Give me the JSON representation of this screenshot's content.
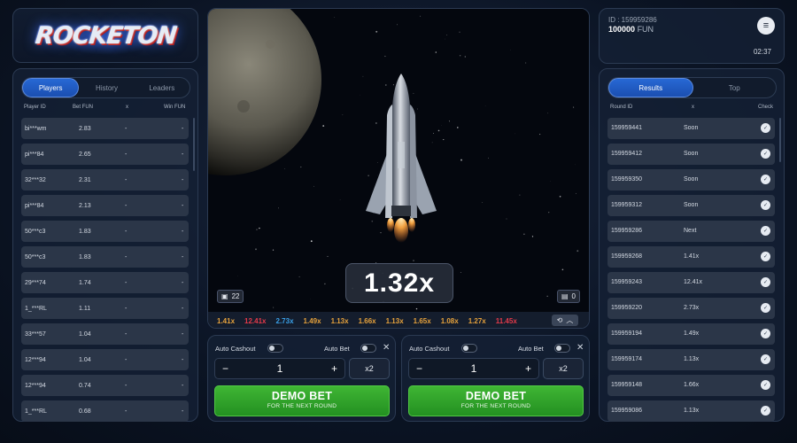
{
  "logo": {
    "text": "ROCKETON"
  },
  "players": {
    "tabs": [
      "Players",
      "History",
      "Leaders"
    ],
    "columns": {
      "id": "Player ID",
      "bet": "Bet  FUN",
      "x": "x",
      "win": "Win  FUN"
    },
    "rows": [
      {
        "id": "bi***wm",
        "bet": "2.83",
        "x": "-",
        "win": "-"
      },
      {
        "id": "pi***84",
        "bet": "2.65",
        "x": "-",
        "win": "-"
      },
      {
        "id": "32***32",
        "bet": "2.31",
        "x": "-",
        "win": "-"
      },
      {
        "id": "pi***84",
        "bet": "2.13",
        "x": "-",
        "win": "-"
      },
      {
        "id": "50***c3",
        "bet": "1.83",
        "x": "-",
        "win": "-"
      },
      {
        "id": "50***c3",
        "bet": "1.83",
        "x": "-",
        "win": "-"
      },
      {
        "id": "29***74",
        "bet": "1.74",
        "x": "-",
        "win": "-"
      },
      {
        "id": "1_***RL",
        "bet": "1.11",
        "x": "-",
        "win": "-"
      },
      {
        "id": "33***57",
        "bet": "1.04",
        "x": "-",
        "win": "-"
      },
      {
        "id": "12***94",
        "bet": "1.04",
        "x": "-",
        "win": "-"
      },
      {
        "id": "12***94",
        "bet": "0.74",
        "x": "-",
        "win": "-"
      },
      {
        "id": "1_***RL",
        "bet": "0.68",
        "x": "-",
        "win": "-"
      }
    ]
  },
  "game": {
    "multiplier": "1.32x",
    "players_count": "22",
    "cashouts_count": "0",
    "history": [
      {
        "v": "1.41x",
        "c": "#e6a23c"
      },
      {
        "v": "12.41x",
        "c": "#e53a4a"
      },
      {
        "v": "2.73x",
        "c": "#3aa0e8"
      },
      {
        "v": "1.49x",
        "c": "#e6a23c"
      },
      {
        "v": "1.13x",
        "c": "#e6a23c"
      },
      {
        "v": "1.66x",
        "c": "#e6a23c"
      },
      {
        "v": "1.13x",
        "c": "#e6a23c"
      },
      {
        "v": "1.65x",
        "c": "#e6a23c"
      },
      {
        "v": "1.08x",
        "c": "#e6a23c"
      },
      {
        "v": "1.27x",
        "c": "#e6a23c"
      },
      {
        "v": "11.45x",
        "c": "#e53a4a"
      }
    ]
  },
  "bet_panels": [
    {
      "auto_cashout": "Auto Cashout",
      "auto_bet": "Auto Bet",
      "stake": "1",
      "x2": "x2",
      "button": "DEMO BET",
      "sub": "FOR THE NEXT ROUND"
    },
    {
      "auto_cashout": "Auto Cashout",
      "auto_bet": "Auto Bet",
      "stake": "1",
      "x2": "x2",
      "button": "DEMO BET",
      "sub": "FOR THE NEXT ROUND"
    }
  ],
  "account": {
    "id": "ID : 159959286",
    "balance": "100000",
    "currency": "FUN",
    "time": "02:37"
  },
  "results": {
    "tabs": [
      "Results",
      "Top"
    ],
    "columns": {
      "round": "Round ID",
      "x": "x",
      "check": "Check"
    },
    "rows": [
      {
        "id": "159959441",
        "x": "Soon"
      },
      {
        "id": "159959412",
        "x": "Soon"
      },
      {
        "id": "159959350",
        "x": "Soon"
      },
      {
        "id": "159959312",
        "x": "Soon"
      },
      {
        "id": "159959286",
        "x": "Next"
      },
      {
        "id": "159959268",
        "x": "1.41x"
      },
      {
        "id": "159959243",
        "x": "12.41x"
      },
      {
        "id": "159959220",
        "x": "2.73x"
      },
      {
        "id": "159959194",
        "x": "1.49x"
      },
      {
        "id": "159959174",
        "x": "1.13x"
      },
      {
        "id": "159959148",
        "x": "1.66x"
      },
      {
        "id": "159959086",
        "x": "1.13x"
      }
    ]
  }
}
